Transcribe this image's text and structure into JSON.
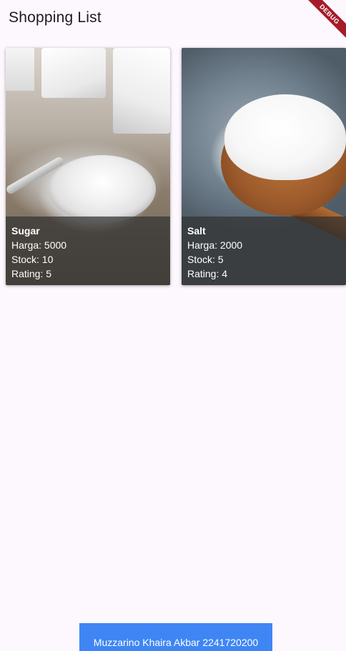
{
  "app_bar": {
    "title": "Shopping List",
    "debug_label": "DEBUG"
  },
  "products": [
    {
      "name": "Sugar",
      "price": "Harga: 5000",
      "stock": "Stock: 10",
      "rating": "Rating: 5",
      "image": "sugar-photo"
    },
    {
      "name": "Salt",
      "price": "Harga: 2000",
      "stock": "Stock: 5",
      "rating": "Rating: 4",
      "image": "salt-photo"
    }
  ],
  "footer": {
    "text": "Muzzarino Khaira Akbar 2241720200"
  },
  "colors": {
    "background": "#fdf7fe",
    "footer": "#3f86f4",
    "debug_banner": "#a61b29",
    "overlay": "rgba(50,50,50,0.72)"
  }
}
